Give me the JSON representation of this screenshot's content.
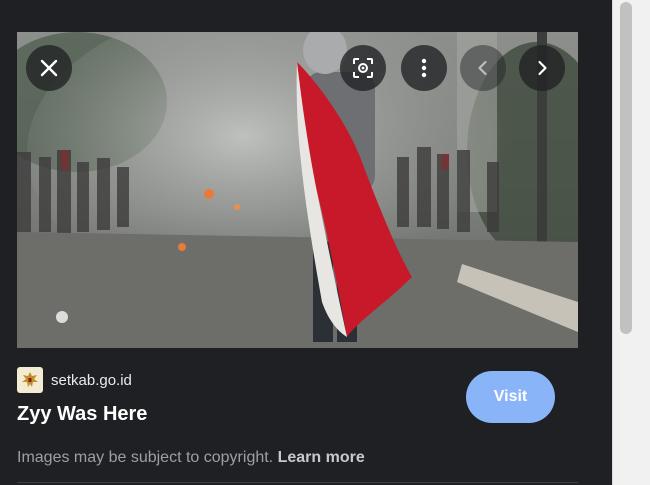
{
  "viewer": {
    "image_alt": "Person carrying a red and white flag through tear gas smoke on a street",
    "controls": {
      "close_icon": "close-icon",
      "lens_icon": "lens-search-icon",
      "more_icon": "more-vert-icon",
      "prev_icon": "chevron-left-icon",
      "next_icon": "chevron-right-icon"
    }
  },
  "source": {
    "domain": "setkab.go.id",
    "favicon": "garuda-emblem-icon"
  },
  "title": "Zyy Was Here",
  "visit_label": "Visit",
  "copyright": {
    "text": "Images may be subject to copyright.",
    "link_label": "Learn more"
  },
  "colors": {
    "background": "#1f2023",
    "accent": "#8ab4f8",
    "flag_red": "#c8192a"
  }
}
